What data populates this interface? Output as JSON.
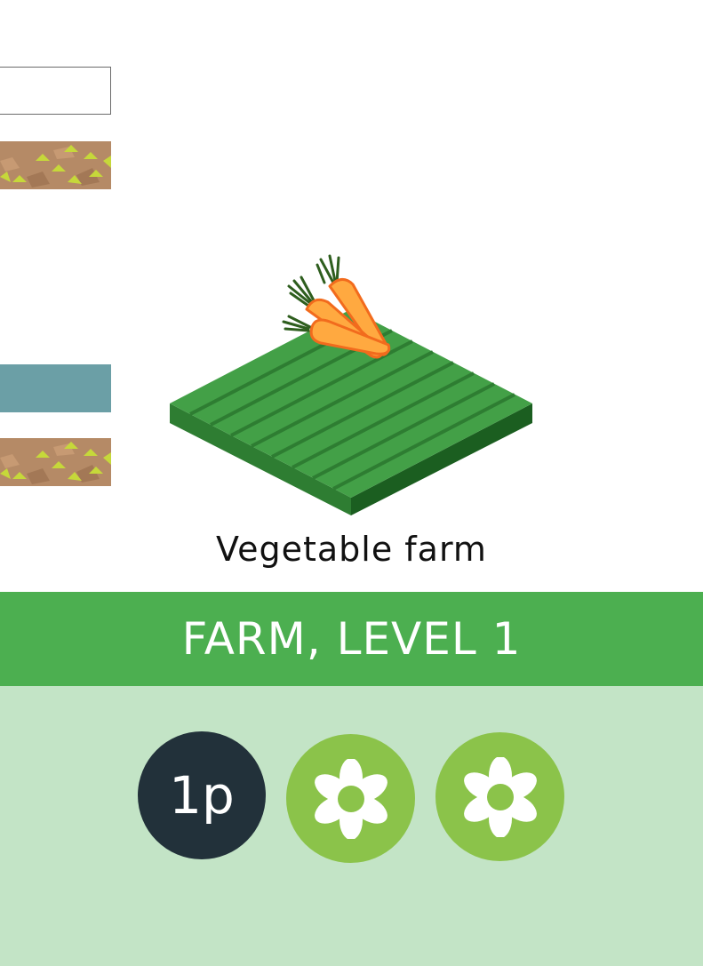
{
  "card": {
    "caption": "Vegetable farm",
    "title": "FARM, LEVEL 1",
    "cost": "1p",
    "rewards": [
      "flower-icon",
      "flower-icon"
    ]
  },
  "colors": {
    "banner": "#4caf50",
    "body": "#c3e4c6",
    "cost_token": "#22313a",
    "flower_token": "#8bc34a",
    "farm_field": "#43a047",
    "carrot": "#ffa940",
    "teal_bar": "#6b9fa6",
    "dirt": "#b58a66"
  },
  "icons": {
    "crop": "carrot-icon",
    "tile": "dirt-tile"
  }
}
